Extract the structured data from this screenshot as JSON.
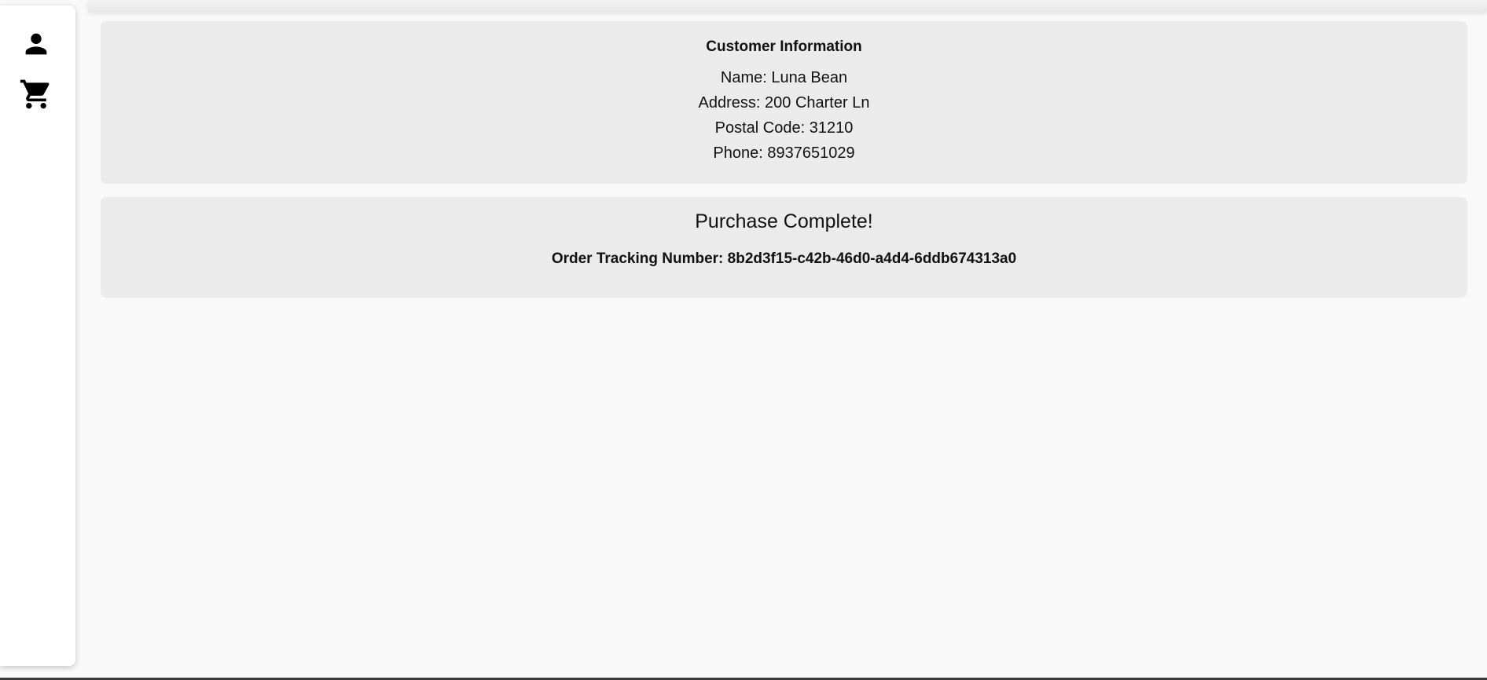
{
  "sidebar": {
    "items": [
      {
        "icon": "person-icon",
        "name": "profile"
      },
      {
        "icon": "shopping-cart-icon",
        "name": "cart"
      }
    ]
  },
  "customer": {
    "title": "Customer Information",
    "name_line": "Name: Luna Bean",
    "address_line": "Address: 200 Charter Ln",
    "postal_line": "Postal Code: 31210",
    "phone_line": "Phone: 8937651029"
  },
  "purchase": {
    "title": "Purchase Complete!",
    "tracking_line": "Order Tracking Number: 8b2d3f15-c42b-46d0-a4d4-6ddb674313a0"
  },
  "colors": {
    "page_background": "#f9f9f9",
    "card_background": "#ebebeb",
    "sidebar_background": "#ffffff"
  }
}
